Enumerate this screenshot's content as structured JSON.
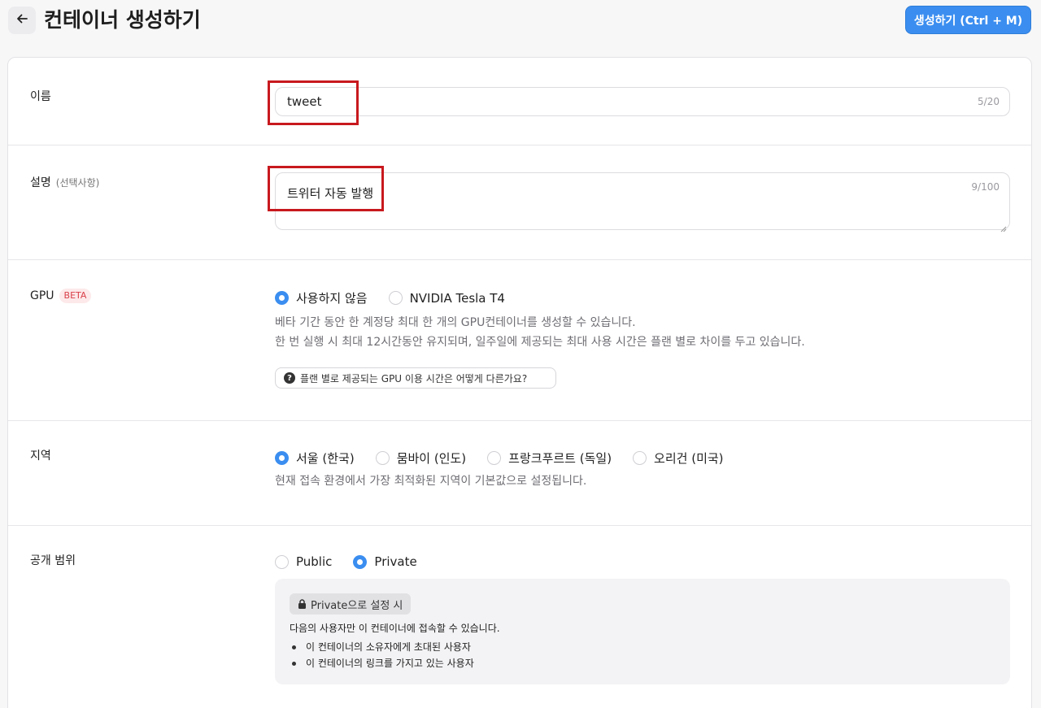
{
  "header": {
    "title": "컨테이너 생성하기",
    "create_button": "생성하기 (Ctrl + M)",
    "back_icon": "arrow-left-icon"
  },
  "name_field": {
    "label": "이름",
    "value": "tweet",
    "counter": "5/20"
  },
  "description_field": {
    "label": "설명",
    "label_hint": "(선택사항)",
    "value": "트위터 자동 발행",
    "counter": "9/100"
  },
  "gpu": {
    "label": "GPU",
    "badge": "BETA",
    "options": [
      {
        "label": "사용하지 않음",
        "selected": true
      },
      {
        "label": "NVIDIA Tesla T4",
        "selected": false
      }
    ],
    "help_line1": "베타 기간 동안 한 계정당 최대 한 개의 GPU컨테이너를 생성할 수 있습니다.",
    "help_line2": "한 번 실행 시 최대 12시간동안 유지되며, 일주일에 제공되는 최대 사용 시간은 플랜 별로 차이를 두고 있습니다.",
    "faq_button": "플랜 별로 제공되는 GPU 이용 시간은 어떻게 다른가요?"
  },
  "region": {
    "label": "지역",
    "options": [
      {
        "label": "서울 (한국)",
        "selected": true
      },
      {
        "label": "뭄바이 (인도)",
        "selected": false
      },
      {
        "label": "프랑크푸르트 (독일)",
        "selected": false
      },
      {
        "label": "오리건 (미국)",
        "selected": false
      }
    ],
    "help": "현재 접속 환경에서 가장 최적화된 지역이 기본값으로 설정됩니다."
  },
  "visibility": {
    "label": "공개 범위",
    "options": [
      {
        "label": "Public",
        "selected": false
      },
      {
        "label": "Private",
        "selected": true
      }
    ],
    "private_tag": "Private으로 설정 시",
    "private_desc": "다음의 사용자만 이 컨테이너에 접속할 수 있습니다.",
    "private_list": [
      "이 컨테이너의 소유자에게 초대된 사용자",
      "이 컨테이너의 링크를 가지고 있는 사용자"
    ]
  },
  "colors": {
    "accent": "#3b8ef0",
    "highlight": "#c8191e",
    "beta": "#d9414a"
  }
}
